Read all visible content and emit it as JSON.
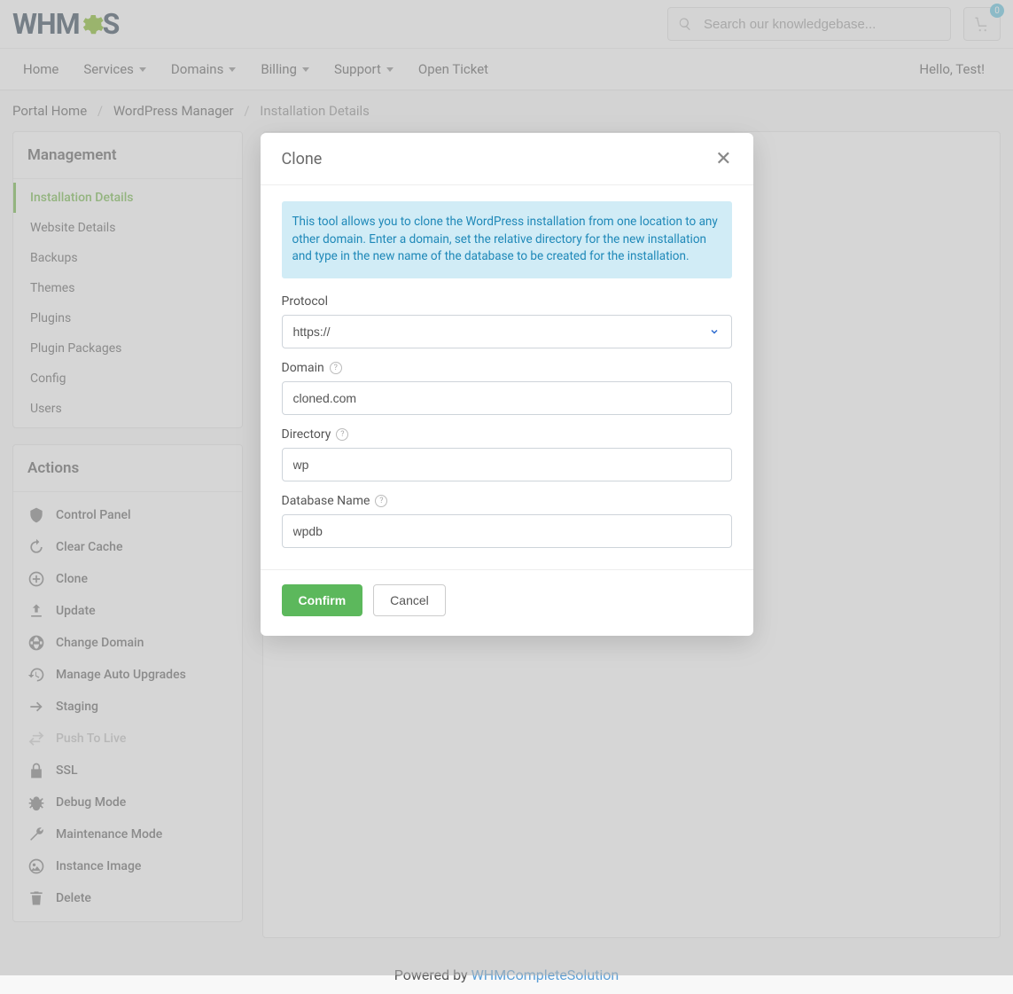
{
  "header": {
    "brand_part1": "WHM",
    "brand_part2": "S",
    "search_placeholder": "Search our knowledgebase...",
    "cart_count": "0"
  },
  "nav": {
    "items": [
      {
        "label": "Home",
        "dropdown": false
      },
      {
        "label": "Services",
        "dropdown": true
      },
      {
        "label": "Domains",
        "dropdown": true
      },
      {
        "label": "Billing",
        "dropdown": true
      },
      {
        "label": "Support",
        "dropdown": true
      },
      {
        "label": "Open Ticket",
        "dropdown": false
      }
    ],
    "hello": "Hello, Test!"
  },
  "breadcrumb": {
    "home": "Portal Home",
    "parent": "WordPress Manager",
    "current": "Installation Details"
  },
  "sidebar": {
    "management": {
      "title": "Management",
      "items": [
        "Installation Details",
        "Website Details",
        "Backups",
        "Themes",
        "Plugins",
        "Plugin Packages",
        "Config",
        "Users"
      ]
    },
    "actions": {
      "title": "Actions",
      "items": [
        {
          "label": "Control Panel",
          "icon": "shield-icon"
        },
        {
          "label": "Clear Cache",
          "icon": "refresh-icon"
        },
        {
          "label": "Clone",
          "icon": "plus-circle-icon"
        },
        {
          "label": "Update",
          "icon": "upload-icon"
        },
        {
          "label": "Change Domain",
          "icon": "globe-icon"
        },
        {
          "label": "Manage Auto Upgrades",
          "icon": "history-icon"
        },
        {
          "label": "Staging",
          "icon": "arrow-right-icon"
        },
        {
          "label": "Push To Live",
          "icon": "swap-icon",
          "disabled": true
        },
        {
          "label": "SSL",
          "icon": "lock-icon"
        },
        {
          "label": "Debug Mode",
          "icon": "bug-icon"
        },
        {
          "label": "Maintenance Mode",
          "icon": "wrench-icon"
        },
        {
          "label": "Instance Image",
          "icon": "image-icon"
        },
        {
          "label": "Delete",
          "icon": "trash-icon"
        }
      ]
    }
  },
  "modal": {
    "title": "Clone",
    "info": "This tool allows you to clone the WordPress installation from one location to any other domain. Enter a domain, set the relative directory for the new installation and type in the new name of the database to be created for the installation.",
    "fields": {
      "protocol": {
        "label": "Protocol",
        "value": "https://"
      },
      "domain": {
        "label": "Domain",
        "value": "cloned.com"
      },
      "directory": {
        "label": "Directory",
        "value": "wp"
      },
      "db": {
        "label": "Database Name",
        "value": "wpdb"
      }
    },
    "confirm": "Confirm",
    "cancel": "Cancel"
  },
  "footer": {
    "powered": "Powered by ",
    "link": "WHMCompleteSolution"
  }
}
